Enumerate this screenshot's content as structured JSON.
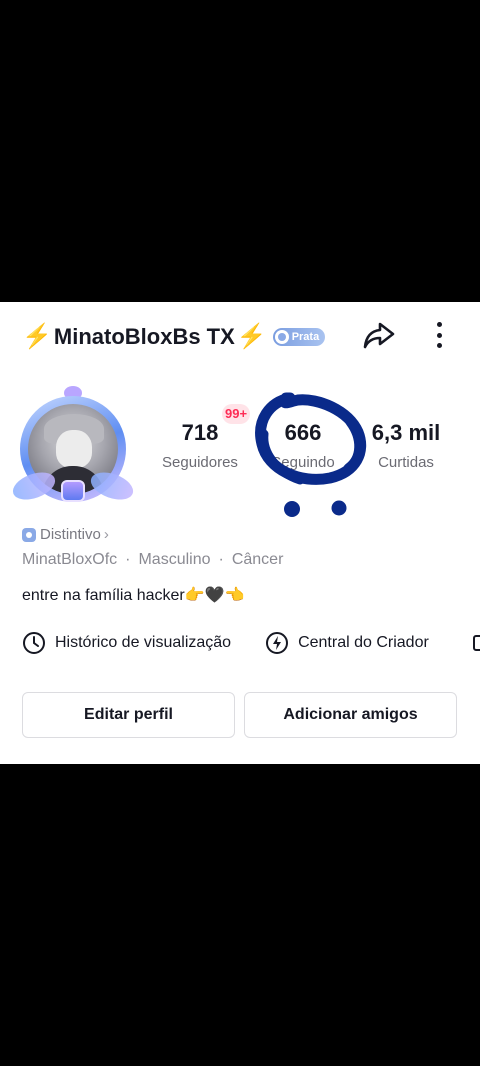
{
  "header": {
    "bolt_left": "⚡",
    "username": "MinatoBloxBs TX",
    "bolt_right": "⚡",
    "tier_label": "Prata"
  },
  "stats": {
    "followers": {
      "value": "718",
      "label": "Seguidores"
    },
    "following": {
      "value": "666",
      "label": "Seguindo",
      "badge": "99+"
    },
    "likes": {
      "value": "6,3 mil",
      "label": "Curtidas"
    }
  },
  "profile": {
    "badge_label": "Distintivo",
    "handle": "MinatBloxOfc",
    "gender": "Masculino",
    "sign": "Câncer",
    "separator": "·",
    "bio": "entre na família hacker👉🖤👈"
  },
  "links": {
    "history": "Histórico de visualização",
    "creator_center": "Central do Criador"
  },
  "buttons": {
    "edit_profile": "Editar perfil",
    "add_friends": "Adicionar amigos"
  },
  "colors": {
    "text": "#161823",
    "secondary": "#6b6b73",
    "scribble": "#0a2a8a",
    "badge_red": "#fe2c55"
  }
}
